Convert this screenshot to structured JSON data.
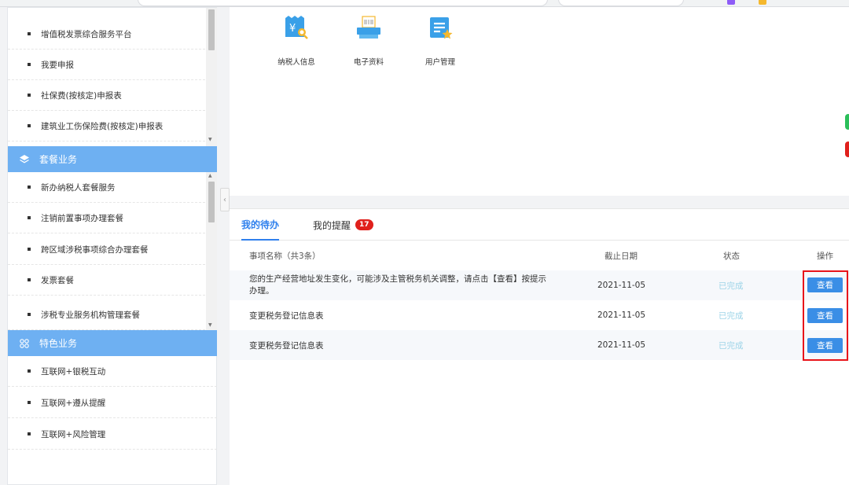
{
  "sidebar": {
    "group1_items": [
      {
        "label": "增值税发票综合服务平台"
      },
      {
        "label": "我要申报"
      },
      {
        "label": "社保费(按核定)申报表"
      },
      {
        "label": "建筑业工伤保险费(按核定)申报表"
      }
    ],
    "group2": {
      "title": "套餐业务",
      "icon": "layers-icon",
      "items": [
        {
          "label": "新办纳税人套餐服务"
        },
        {
          "label": "注销前置事项办理套餐"
        },
        {
          "label": "跨区域涉税事项综合办理套餐"
        },
        {
          "label": "发票套餐"
        },
        {
          "label": "涉税专业服务机构管理套餐"
        }
      ]
    },
    "group3": {
      "title": "特色业务",
      "icon": "grid-icon",
      "items": [
        {
          "label": "互联网+银税互动"
        },
        {
          "label": "互联网+遵从提醒"
        },
        {
          "label": "互联网+风险管理"
        }
      ]
    }
  },
  "tools": [
    {
      "label": "纳税人信息",
      "icon": "taxpayer-info-icon"
    },
    {
      "label": "电子资料",
      "icon": "electronic-documents-icon"
    },
    {
      "label": "用户管理",
      "icon": "user-management-icon"
    }
  ],
  "tabs": {
    "todo": "我的待办",
    "reminders": "我的提醒",
    "reminder_count": "17"
  },
  "table": {
    "headers": {
      "name": "事项名称（共3条）",
      "deadline": "截止日期",
      "status": "状态",
      "action": "操作"
    },
    "rows": [
      {
        "name_line1": "您的生产经营地址发生变化，可能涉及主管税务机关调整，请点击【查看】按提示",
        "name_line2": "办理。",
        "deadline": "2021-11-05",
        "status": "已完成",
        "action": "查看"
      },
      {
        "name_line1": "变更税务登记信息表",
        "deadline": "2021-11-05",
        "status": "已完成",
        "action": "查看"
      },
      {
        "name_line1": "变更税务登记信息表",
        "deadline": "2021-11-05",
        "status": "已完成",
        "action": "查看"
      }
    ]
  },
  "colors": {
    "accent": "#2f80ed",
    "sidebar_header": "#6eb0f2",
    "button": "#3a8ee6",
    "badge": "#e0201c",
    "highlight_box": "#e8141a",
    "status_done": "#9dd4e8"
  }
}
